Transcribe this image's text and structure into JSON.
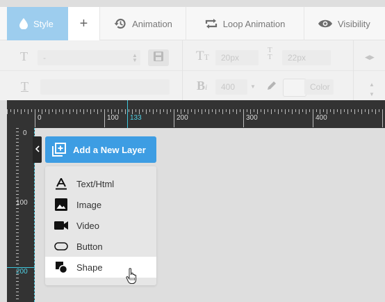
{
  "tabs": [
    {
      "label": "Style",
      "icon": "droplet-icon",
      "active": true
    },
    {
      "label": "+",
      "icon": "plus-icon"
    },
    {
      "label": "Animation",
      "icon": "history-icon"
    },
    {
      "label": "Loop Animation",
      "icon": "loop-icon"
    },
    {
      "label": "Visibility",
      "icon": "eye-icon"
    }
  ],
  "toolbar": {
    "font_select_value": "-",
    "font_size_value": "20px",
    "line_height_value": "22px",
    "font_weight_value": "400",
    "color_label": "Color"
  },
  "ruler": {
    "h_labels": [
      "0",
      "100",
      "200",
      "300",
      "400"
    ],
    "h_current": "133",
    "v_labels": [
      "0",
      "100"
    ],
    "v_current": "200"
  },
  "add_layer": {
    "label": "Add a New Layer"
  },
  "menu": {
    "items": [
      {
        "label": "Text/Html",
        "icon": "text-icon"
      },
      {
        "label": "Image",
        "icon": "image-icon"
      },
      {
        "label": "Video",
        "icon": "video-icon"
      },
      {
        "label": "Button",
        "icon": "button-icon"
      },
      {
        "label": "Shape",
        "icon": "shape-icon",
        "highlighted": true
      }
    ]
  },
  "colors": {
    "active_tab": "#9dcdee",
    "primary_button": "#3d9de3",
    "ruler_bg": "#333333",
    "ruler_accent": "#3fc7dd"
  }
}
